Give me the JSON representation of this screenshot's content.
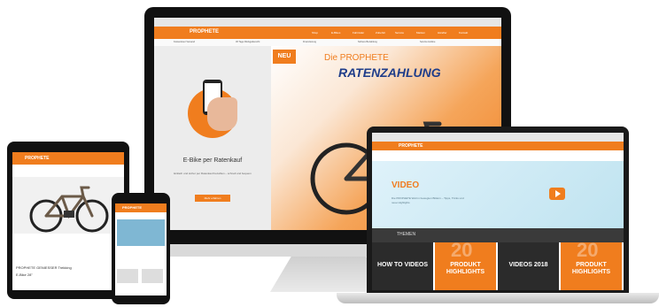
{
  "brand": {
    "logo": "PROPHETE",
    "accent": "#f07d1e",
    "dark": "#111111",
    "navy": "#1f3d8a"
  },
  "desktop": {
    "nav_items": [
      "Shop",
      "E-Bikes",
      "Fahrräder",
      "Zubehör",
      "Service",
      "Marken",
      "Händler",
      "Kontakt"
    ],
    "info_items": [
      "Kostenloser Versand",
      "30 Tage Rückgaberecht",
      "Finanzierung",
      "Sichere Bezahlung",
      "Service Hotline"
    ],
    "left_panel": {
      "title": "E-Bike per Ratenkauf",
      "text": "Einfach und sicher per Ratenkauf bezahlen – schnell und bequem",
      "button": "Mehr erfahren"
    },
    "hero": {
      "badge": "NEU",
      "line1": "Die PROPHETE",
      "line2": "RATENZAHLUNG"
    }
  },
  "tablet": {
    "text1": "PROPHETE GENIESSER Trekking",
    "text2": "E-Bike 28\""
  },
  "phone": {},
  "laptop": {
    "video_title": "VIDEO",
    "video_text": "Die PROPHETE Welt in bewegten Bildern – Tipps, Tricks und neue Highlights",
    "themen_label": "THEMEN",
    "tiles": [
      {
        "big": "",
        "label": "HOW TO VIDEOS",
        "color": "#2b2b2b"
      },
      {
        "big": "20",
        "label": "PRODUKT HIGHLIGHTS",
        "color": "#f07d1e"
      },
      {
        "big": "",
        "label": "VIDEOS 2018",
        "color": "#2b2b2b"
      },
      {
        "big": "20",
        "label": "PRODUKT HIGHLIGHTS",
        "color": "#f07d1e"
      }
    ]
  }
}
